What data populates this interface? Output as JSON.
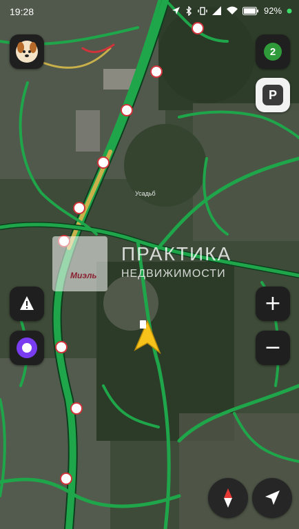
{
  "status_bar": {
    "time": "19:28",
    "battery": "92",
    "icons": [
      "navigation-icon",
      "bluetooth-icon",
      "vibrate-icon",
      "signal-icon",
      "wifi-icon",
      "battery-icon",
      "notification-dot"
    ]
  },
  "map": {
    "place_label": "Усадьб",
    "watermark": {
      "logo_text": "Миэль",
      "line1": "ПРАКТИКА",
      "line2": "НЕДВИЖИМОСТИ"
    },
    "traffic_colors": {
      "free": "#1fa64a",
      "medium": "#c8b04a",
      "heavy": "#d0343a"
    },
    "cursor_color": "#f7c21a"
  },
  "controls": {
    "layers_badge": "2",
    "parking_label": "P",
    "zoom_in_label": "+",
    "zoom_out_label": "−"
  }
}
